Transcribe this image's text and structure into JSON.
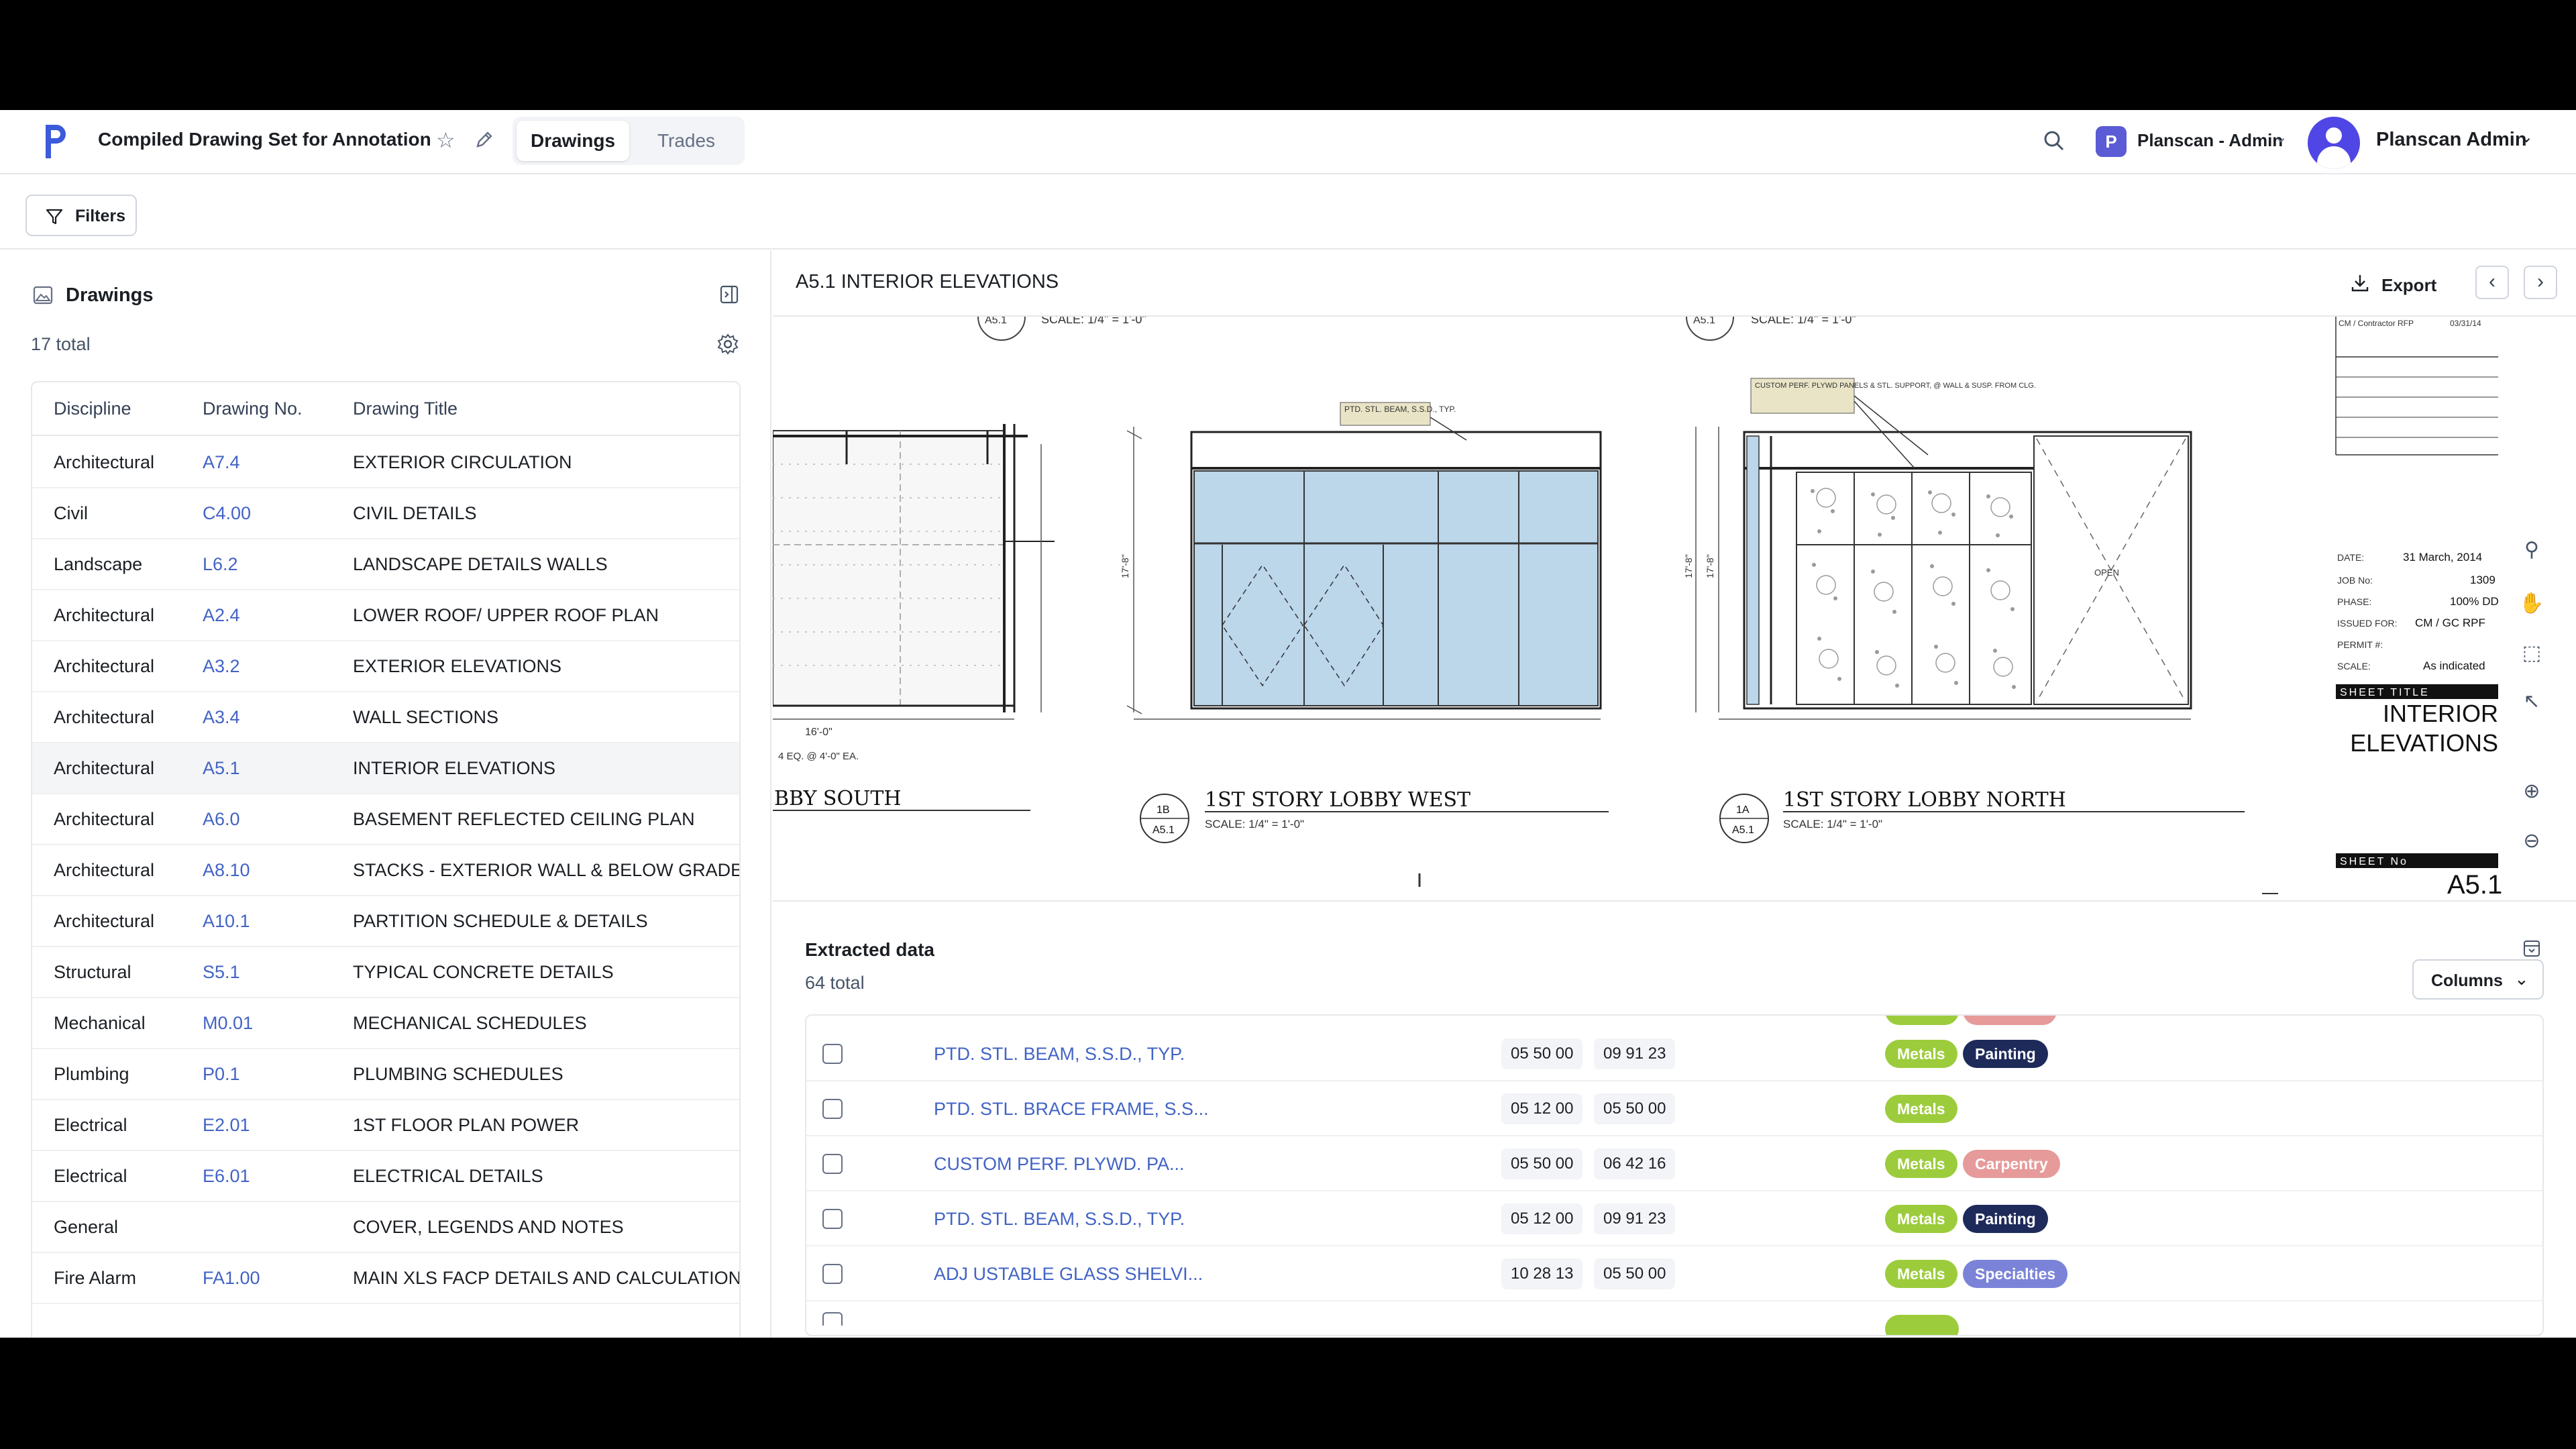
{
  "header": {
    "doc_title": "Compiled Drawing Set for Annotation",
    "tabs": [
      "Drawings",
      "Trades"
    ],
    "org_initial": "P",
    "org_name": "Planscan - Admin",
    "user_name": "Planscan Admin"
  },
  "filters_label": "Filters",
  "drawings_panel": {
    "title": "Drawings",
    "total": "17 total",
    "columns": [
      "Discipline",
      "Drawing No.",
      "Drawing Title"
    ],
    "rows": [
      {
        "discipline": "Architectural",
        "number": "A7.4",
        "title": "EXTERIOR CIRCULATION"
      },
      {
        "discipline": "Civil",
        "number": "C4.00",
        "title": "CIVIL DETAILS"
      },
      {
        "discipline": "Landscape",
        "number": "L6.2",
        "title": "LANDSCAPE DETAILS WALLS"
      },
      {
        "discipline": "Architectural",
        "number": "A2.4",
        "title": "LOWER ROOF/ UPPER ROOF PLAN"
      },
      {
        "discipline": "Architectural",
        "number": "A3.2",
        "title": "EXTERIOR ELEVATIONS"
      },
      {
        "discipline": "Architectural",
        "number": "A3.4",
        "title": "WALL SECTIONS"
      },
      {
        "discipline": "Architectural",
        "number": "A5.1",
        "title": "INTERIOR ELEVATIONS"
      },
      {
        "discipline": "Architectural",
        "number": "A6.0",
        "title": "BASEMENT REFLECTED CEILING PLAN"
      },
      {
        "discipline": "Architectural",
        "number": "A8.10",
        "title": "STACKS - EXTERIOR WALL & BELOW GRADE DE"
      },
      {
        "discipline": "Architectural",
        "number": "A10.1",
        "title": "PARTITION SCHEDULE & DETAILS"
      },
      {
        "discipline": "Structural",
        "number": "S5.1",
        "title": "TYPICAL CONCRETE DETAILS"
      },
      {
        "discipline": "Mechanical",
        "number": "M0.01",
        "title": "MECHANICAL SCHEDULES"
      },
      {
        "discipline": "Plumbing",
        "number": "P0.1",
        "title": "PLUMBING SCHEDULES"
      },
      {
        "discipline": "Electrical",
        "number": "E2.01",
        "title": "1ST FLOOR PLAN POWER"
      },
      {
        "discipline": "Electrical",
        "number": "E6.01",
        "title": "ELECTRICAL DETAILS"
      },
      {
        "discipline": "General",
        "number": "",
        "title": "COVER, LEGENDS AND NOTES"
      },
      {
        "discipline": "Fire Alarm",
        "number": "FA1.00",
        "title": "MAIN XLS FACP DETAILS AND CALCULATIONS"
      }
    ]
  },
  "viewer": {
    "title": "A5.1 INTERIOR ELEVATIONS",
    "export_label": "Export",
    "sheet": {
      "scale_top": "SCALE: 1/4\" = 1'-0\"",
      "view_south": "BBY SOUTH",
      "view_west": "1ST STORY LOBBY WEST",
      "view_north": "1ST STORY LOBBY NORTH",
      "tag_1b": "1B",
      "tag_1a": "1A",
      "sheet_ref": "A5.1",
      "note_beam": "PTD. STL. BEAM, S.S.D., TYP.",
      "note_panels": "CUSTOM PERF. PLYWD PANELS & STL. SUPPORT, @ WALL & SUSP. FROM CLG.",
      "open_label": "OPEN",
      "dim_left": "16'-0\"",
      "dim_eq": "4 EQ. @ 4'-0\" EA.",
      "date_label": "DATE:",
      "date_value": "31 March, 2014",
      "job_label": "JOB No:",
      "job_value": "1309",
      "phase_label": "PHASE:",
      "phase_value": "100% DD",
      "issued_label": "ISSUED FOR:",
      "issued_value": "CM / GC RPF",
      "permit_label": "PERMIT #:",
      "scale_label": "SCALE:",
      "scale_value": "As indicated",
      "sheet_title_label": "SHEET TITLE",
      "sheet_title_1": "INTERIOR",
      "sheet_title_2": "ELEVATIONS",
      "sheet_no_label": "SHEET No",
      "sheet_no": "A5.1",
      "contractor": "CM / Contractor RFP",
      "contractor_date": "03/31/14"
    }
  },
  "extracted": {
    "title": "Extracted data",
    "total": "64 total",
    "columns_label": "Columns",
    "rows": [
      {
        "name": "PTD. STL. BEAM, S.S.D., TYP.",
        "codes": [
          "05 50 00",
          "09 91 23"
        ],
        "tags": [
          "Metals",
          "Painting"
        ]
      },
      {
        "name": "PTD. STL. BRACE FRAME, S.S...",
        "codes": [
          "05 12 00",
          "05 50 00"
        ],
        "tags": [
          "Metals"
        ]
      },
      {
        "name": "CUSTOM PERF. PLYWD. PA...",
        "codes": [
          "05 50 00",
          "06 42 16"
        ],
        "tags": [
          "Metals",
          "Carpentry"
        ]
      },
      {
        "name": "PTD. STL. BEAM, S.S.D., TYP.",
        "codes": [
          "05 12 00",
          "09 91 23"
        ],
        "tags": [
          "Metals",
          "Painting"
        ]
      },
      {
        "name": "ADJ USTABLE GLASS SHELVI...",
        "codes": [
          "10 28 13",
          "05 50 00"
        ],
        "tags": [
          "Metals",
          "Specialties"
        ]
      }
    ]
  },
  "colors": {
    "accent": "#4263c5",
    "brand": "#4f46e5",
    "metals": "#9ccc3c",
    "painting": "#1e2a5a",
    "carpentry": "#e69a9a",
    "specialties": "#7b83d9",
    "glass": "#bcd6ea"
  }
}
